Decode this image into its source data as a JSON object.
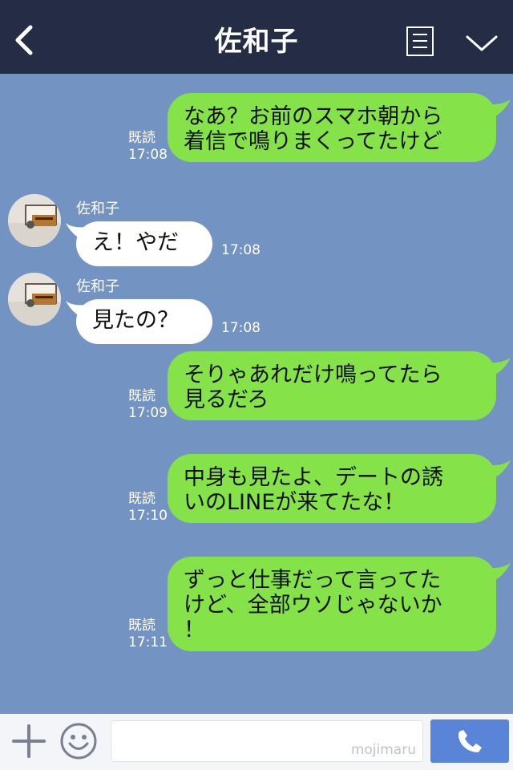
{
  "header": {
    "title": "佐和子",
    "back_icon": "chevron-left-icon",
    "menu_icon": "menu-icon",
    "collapse_icon": "chevron-down-icon",
    "bg": "#242d45"
  },
  "colors": {
    "chat_bg": "#7393c2",
    "outgoing_bubble": "#85e249",
    "incoming_bubble": "#ffffff",
    "send_button": "#5a84d8"
  },
  "messages": [
    {
      "direction": "outgoing",
      "text_lines": [
        "なあ？お前のスマホ朝から",
        "着信で鳴りまくってたけど"
      ],
      "read": "既読",
      "time": "17:08"
    },
    {
      "direction": "incoming",
      "sender": "佐和子",
      "text": "え！やだ",
      "time": "17:08"
    },
    {
      "direction": "incoming",
      "sender": "佐和子",
      "text": "見たの？",
      "time": "17:08"
    },
    {
      "direction": "outgoing",
      "text_lines": [
        "そりゃあれだけ鳴ってたら",
        "見るだろ"
      ],
      "read": "既読",
      "time": "17:09"
    },
    {
      "direction": "outgoing",
      "text_lines": [
        "中身も見たよ、デートの誘",
        "いのLINEが来てたな！"
      ],
      "read": "既読",
      "time": "17:10"
    },
    {
      "direction": "outgoing",
      "text_lines": [
        "ずっと仕事だって言ってた",
        "けど、全部ウソじゃないか",
        "！"
      ],
      "read": "既読",
      "time": "17:11"
    }
  ],
  "input_bar": {
    "plus_icon": "plus-icon",
    "emoji_icon": "smiley-icon",
    "watermark": "mojimaru",
    "call_icon": "phone-icon"
  }
}
